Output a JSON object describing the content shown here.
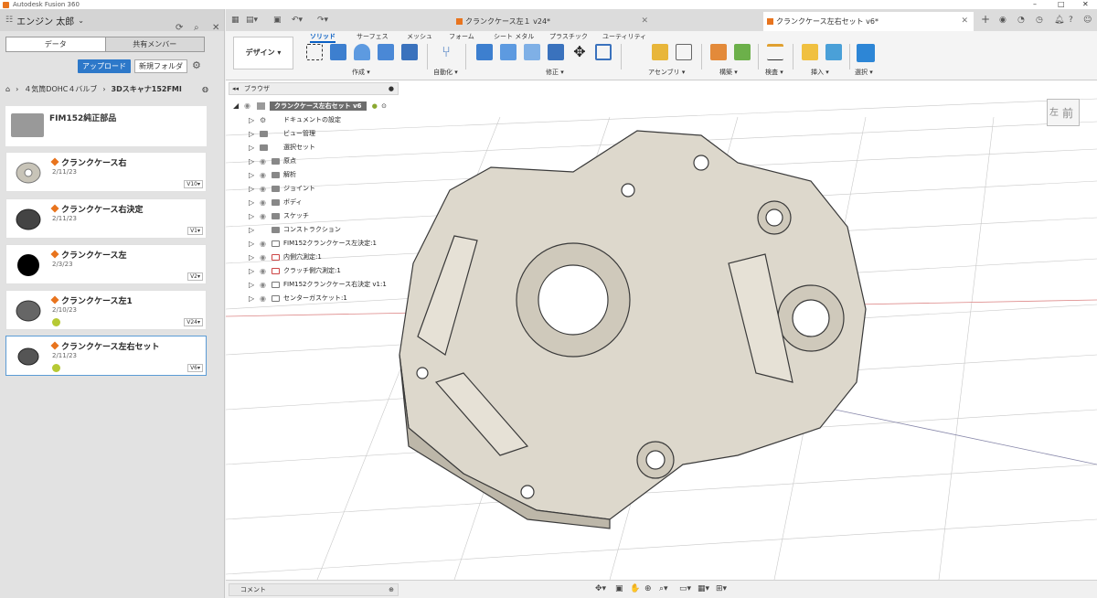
{
  "app": {
    "title": "Autodesk Fusion 360"
  },
  "datapanel": {
    "user": "エンジン 太郎",
    "tabs": [
      "データ",
      "共有メンバー"
    ],
    "upload": "アップロード",
    "new_folder": "新規フォルダ",
    "breadcrumb": [
      "４気筒DOHC４バルブ",
      "3Dスキャナ152FMI"
    ],
    "folder": {
      "title": "FIM152純正部品"
    },
    "items": [
      {
        "title": "クランクケース右",
        "date": "2/11/23",
        "version": "V10▾"
      },
      {
        "title": "クランクケース右決定",
        "date": "2/11/23",
        "version": "V1▾"
      },
      {
        "title": "クランクケース左",
        "date": "2/3/23",
        "version": "V2▾"
      },
      {
        "title": "クランクケース左1",
        "date": "2/10/23",
        "version": "V24▾"
      },
      {
        "title": "クランクケース左右セット",
        "date": "2/11/23",
        "version": "V6▾"
      }
    ]
  },
  "tabs": [
    {
      "label": "クランクケース左１ v24*"
    },
    {
      "label": "クランクケース左右セット v6*"
    }
  ],
  "toolbar": {
    "design": "デザイン ▾",
    "workspaces": [
      "ソリッド",
      "サーフェス",
      "メッシュ",
      "フォーム",
      "シート メタル",
      "プラスチック",
      "ユーティリティ"
    ],
    "groups": [
      "作成 ▾",
      "自動化 ▾",
      "修正 ▾",
      "アセンブリ ▾",
      "構築 ▾",
      "検査 ▾",
      "挿入 ▾",
      "選択 ▾"
    ]
  },
  "browser": {
    "title": "ブラウザ",
    "root": "クランクケース左右セット v6",
    "nodes": [
      "ドキュメントの設定",
      "ビュー管理",
      "選択セット",
      "原点",
      "解析",
      "ジョイント",
      "ボディ",
      "スケッチ",
      "コンストラクション",
      "FIM152クランクケース左決定:1",
      "内側穴測定:1",
      "クラッチ側穴測定:1",
      "FIM152クランクケース右決定 v1:1",
      "センターガスケット:1"
    ]
  },
  "viewcube": {
    "face": "前",
    "left_face": "左"
  },
  "bottom": {
    "comment": "コメント"
  }
}
